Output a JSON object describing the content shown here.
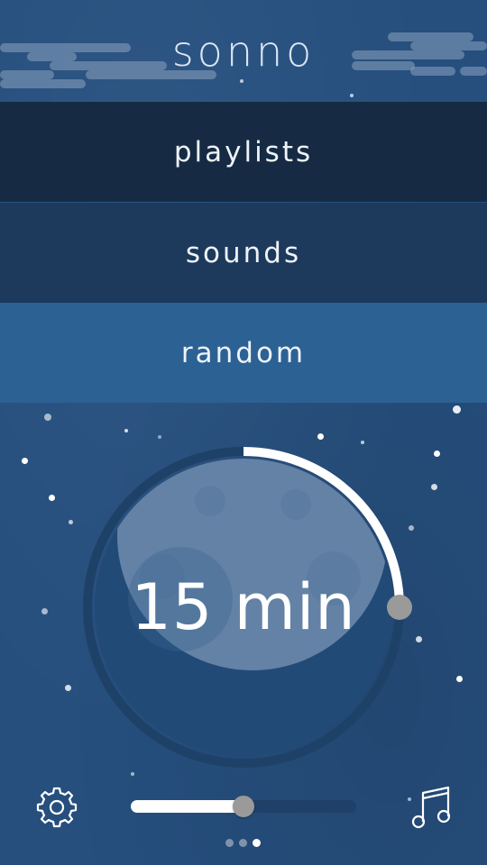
{
  "app": {
    "title": "sonno"
  },
  "menu": {
    "items": [
      {
        "label": "playlists"
      },
      {
        "label": "sounds"
      },
      {
        "label": "random",
        "selected": true
      }
    ]
  },
  "timer": {
    "label": "15 min",
    "progress_fraction": 0.25
  },
  "volume": {
    "level_fraction": 0.5
  },
  "pager": {
    "count": 3,
    "active_index": 2
  },
  "icons": {
    "settings": "gear-icon",
    "music": "music-note-icon"
  },
  "colors": {
    "background": "#264f7e",
    "menu_playlists": "#162b43",
    "menu_sounds": "#1d3a5c",
    "menu_random": "#2c6194",
    "accent": "#ffffff",
    "knob": "#9a9a9a"
  }
}
